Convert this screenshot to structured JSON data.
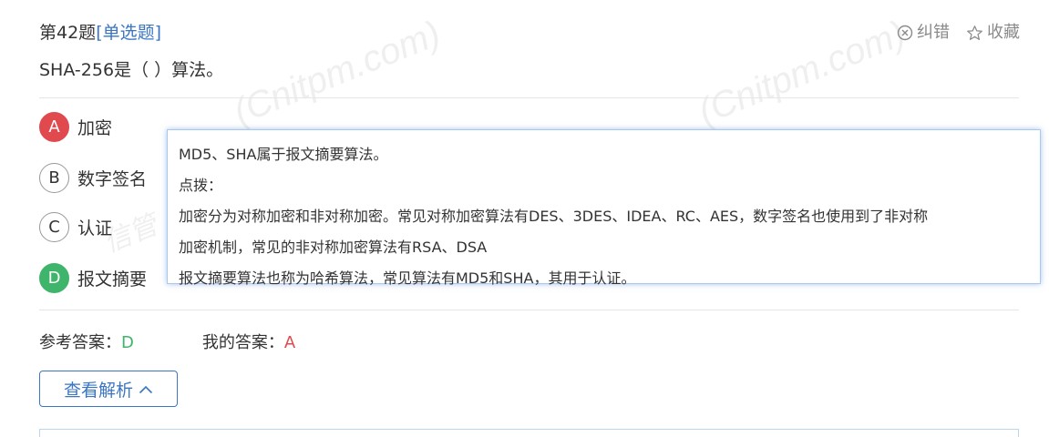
{
  "header": {
    "question_number": "第42题",
    "question_type": "[单选题]"
  },
  "actions": [
    {
      "icon": "report-error-icon",
      "label": "纠错"
    },
    {
      "icon": "star-icon",
      "label": "收藏"
    }
  ],
  "question": {
    "stem": "SHA-256是（  ）算法。"
  },
  "options": [
    {
      "letter": "A",
      "text": "加密",
      "state": "wrong"
    },
    {
      "letter": "B",
      "text": "数字签名",
      "state": "normal"
    },
    {
      "letter": "C",
      "text": "认证",
      "state": "normal"
    },
    {
      "letter": "D",
      "text": "报文摘要",
      "state": "right"
    }
  ],
  "tooltip": {
    "lines": [
      "MD5、SHA属于报文摘要算法。",
      "点拨：",
      "加密分为对称加密和非对称加密。常见对称加密算法有DES、3DES、IDEA、RC、AES，数字签名也使用到了非对称",
      "加密机制，常见的非对称加密算法有RSA、DSA",
      "报文摘要算法也称为哈希算法，常见算法有MD5和SHA，其用于认证。"
    ]
  },
  "answers": {
    "reference_label": "参考答案：",
    "reference_value": "D",
    "mine_label": "我的答案：",
    "mine_value": "A"
  },
  "view_analysis": {
    "label": "查看解析",
    "icon": "chevron-up-icon"
  },
  "watermark": {
    "text": "(Cnitpm.com)",
    "brand": "信管"
  },
  "colors": {
    "accent": "#3a76c4",
    "correct": "#3fb46b",
    "wrong": "#e04a4f",
    "muted": "#8a8a8a"
  }
}
